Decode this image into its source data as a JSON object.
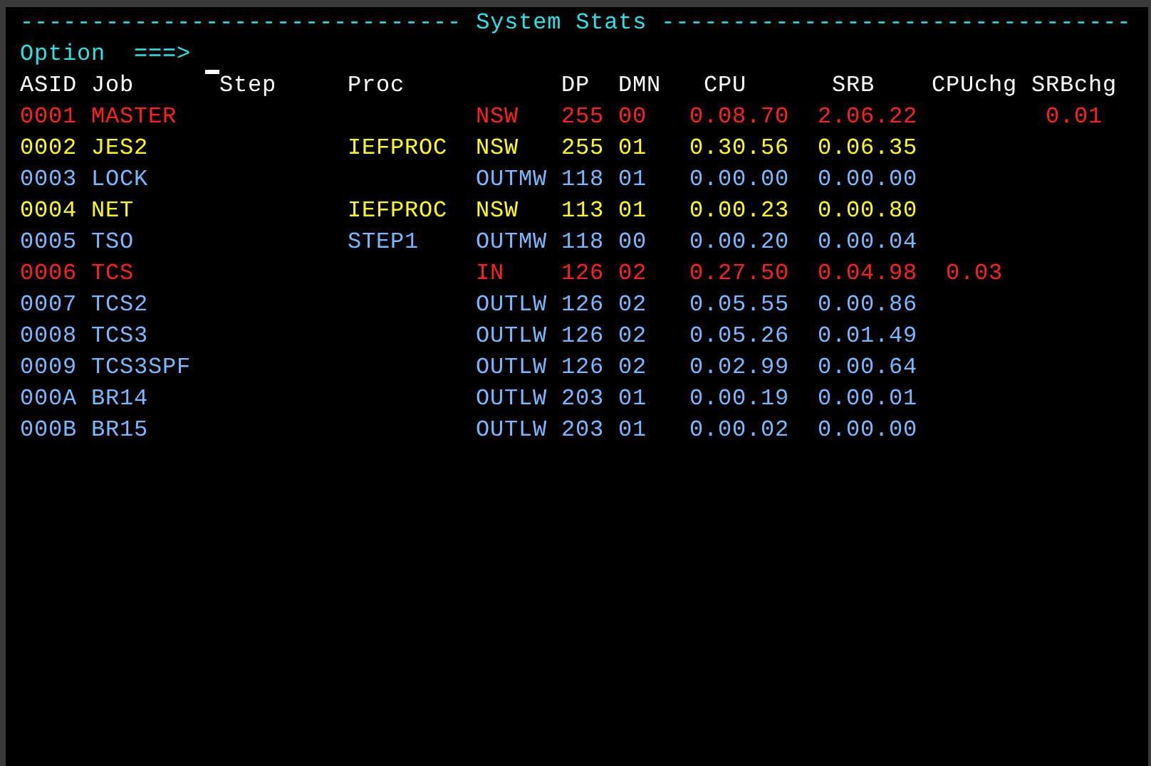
{
  "header": {
    "rule_left": "-------------------------------",
    "title": "System Stats",
    "rule_right": "---------------------------------"
  },
  "command": {
    "label": "Option",
    "prompt": "===>"
  },
  "table": {
    "columns": [
      "ASID",
      "Job",
      "Step",
      "Proc",
      "",
      "DP",
      "DMN",
      "CPU",
      "SRB",
      "CPUchg",
      "SRBchg"
    ],
    "rows": [
      {
        "color": "#ff1f1f",
        "cells": [
          "0001",
          "MASTER",
          null,
          null,
          "NSW",
          "255",
          "00",
          "0.08.70",
          "2.06.22",
          null,
          "0.01"
        ]
      },
      {
        "color": "#ffff00",
        "cells": [
          "0002",
          "JES2",
          null,
          "IEFPROC",
          "NSW",
          "255",
          "01",
          "0.30.56",
          "0.06.35",
          null,
          null
        ]
      },
      {
        "color": "#78b8ff",
        "cells": [
          "0003",
          "LOCK",
          null,
          null,
          "OUTMW",
          "118",
          "01",
          "0.00.00",
          "0.00.00",
          null,
          null
        ]
      },
      {
        "color": "#ffff00",
        "cells": [
          "0004",
          "NET",
          null,
          "IEFPROC",
          "NSW",
          "113",
          "01",
          "0.00.23",
          "0.00.80",
          null,
          null
        ]
      },
      {
        "color": "#78b8ff",
        "cells": [
          "0005",
          "TSO",
          null,
          "STEP1",
          "OUTMW",
          "118",
          "00",
          "0.00.20",
          "0.00.04",
          null,
          null
        ]
      },
      {
        "color": "#ff1f1f",
        "cells": [
          "0006",
          "TCS",
          null,
          null,
          "IN",
          "126",
          "02",
          "0.27.50",
          "0.04.98",
          "0.03",
          null
        ]
      },
      {
        "color": "#78b8ff",
        "cells": [
          "0007",
          "TCS2",
          null,
          null,
          "OUTLW",
          "126",
          "02",
          "0.05.55",
          "0.00.86",
          null,
          null
        ]
      },
      {
        "color": "#78b8ff",
        "cells": [
          "0008",
          "TCS3",
          null,
          null,
          "OUTLW",
          "126",
          "02",
          "0.05.26",
          "0.01.49",
          null,
          null
        ]
      },
      {
        "color": "#78b8ff",
        "cells": [
          "0009",
          "TCS3SPF",
          null,
          null,
          "OUTLW",
          "126",
          "02",
          "0.02.99",
          "0.00.64",
          null,
          null
        ]
      },
      {
        "color": "#78b8ff",
        "cells": [
          "000A",
          "BR14",
          null,
          null,
          "OUTLW",
          "203",
          "01",
          "0.00.19",
          "0.00.01",
          null,
          null
        ]
      },
      {
        "color": "#78b8ff",
        "cells": [
          "000B",
          "BR15",
          null,
          null,
          "OUTLW",
          "203",
          "01",
          "0.00.02",
          "0.00.00",
          null,
          null
        ]
      }
    ]
  }
}
